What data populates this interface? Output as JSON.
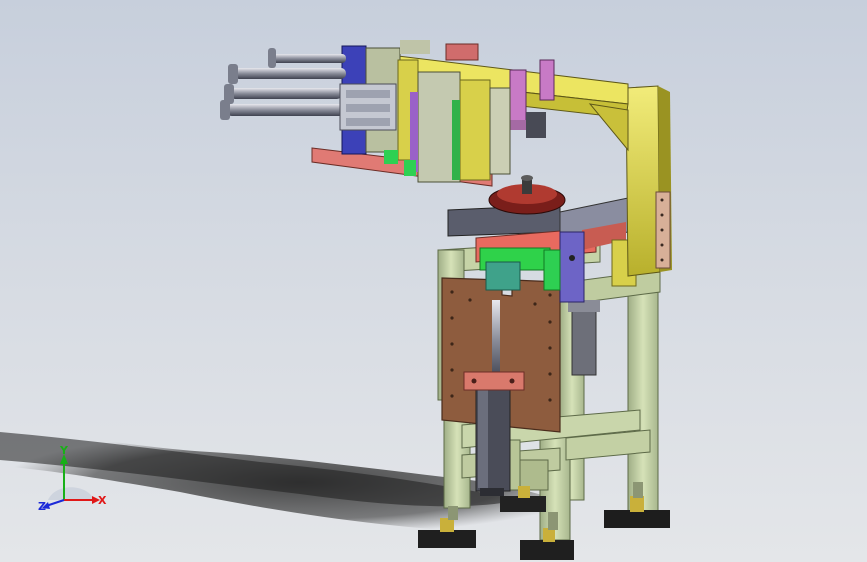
{
  "viewport": {
    "background_top": "#c7cfdc",
    "background_bottom": "#e4e6e9"
  },
  "triad": {
    "x_label": "X",
    "y_label": "Y",
    "z_label": "Z",
    "x_color": "#e01818",
    "y_color": "#18b018",
    "z_color": "#1c2ad8"
  },
  "model": {
    "frame_color": "#c8d4a8",
    "arm_color": "#e6df52",
    "plate_color": "#8a5a3c",
    "slide_color": "#7a7f92",
    "accent_purple": "#6d64c6",
    "accent_pink": "#d06c6c"
  }
}
